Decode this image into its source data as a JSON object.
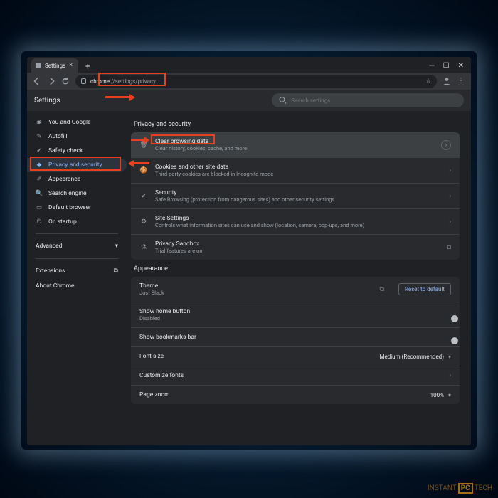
{
  "tab": {
    "title": "Settings"
  },
  "url": {
    "display_host": "chrome",
    "display_path": "://settings/privacy"
  },
  "settings_header": {
    "title": "Settings",
    "search_placeholder": "Search settings"
  },
  "sidebar": {
    "items": [
      {
        "label": "You and Google"
      },
      {
        "label": "Autofill"
      },
      {
        "label": "Safety check"
      },
      {
        "label": "Privacy and security"
      },
      {
        "label": "Appearance"
      },
      {
        "label": "Search engine"
      },
      {
        "label": "Default browser"
      },
      {
        "label": "On startup"
      }
    ],
    "advanced": "Advanced",
    "extensions": "Extensions",
    "about": "About Chrome"
  },
  "sections": {
    "privacy": {
      "title": "Privacy and security",
      "rows": [
        {
          "title": "Clear browsing data",
          "sub": "Clear history, cookies, cache, and more"
        },
        {
          "title": "Cookies and other site data",
          "sub": "Third-party cookies are blocked in Incognito mode"
        },
        {
          "title": "Security",
          "sub": "Safe Browsing (protection from dangerous sites) and other security settings"
        },
        {
          "title": "Site Settings",
          "sub": "Controls what information sites can use and show (location, camera, pop-ups, and more)"
        },
        {
          "title": "Privacy Sandbox",
          "sub": "Trial features are on"
        }
      ]
    },
    "appearance": {
      "title": "Appearance",
      "theme": {
        "title": "Theme",
        "sub": "Just Black",
        "reset": "Reset to default"
      },
      "home_button": {
        "title": "Show home button",
        "sub": "Disabled"
      },
      "bookmarks_bar": {
        "title": "Show bookmarks bar"
      },
      "font_size": {
        "title": "Font size",
        "value": "Medium (Recommended)"
      },
      "customize_fonts": {
        "title": "Customize fonts"
      },
      "page_zoom": {
        "title": "Page zoom",
        "value": "100%"
      }
    }
  },
  "watermark": {
    "a": "INSTANT",
    "b": "PC",
    "c": "TECH"
  }
}
